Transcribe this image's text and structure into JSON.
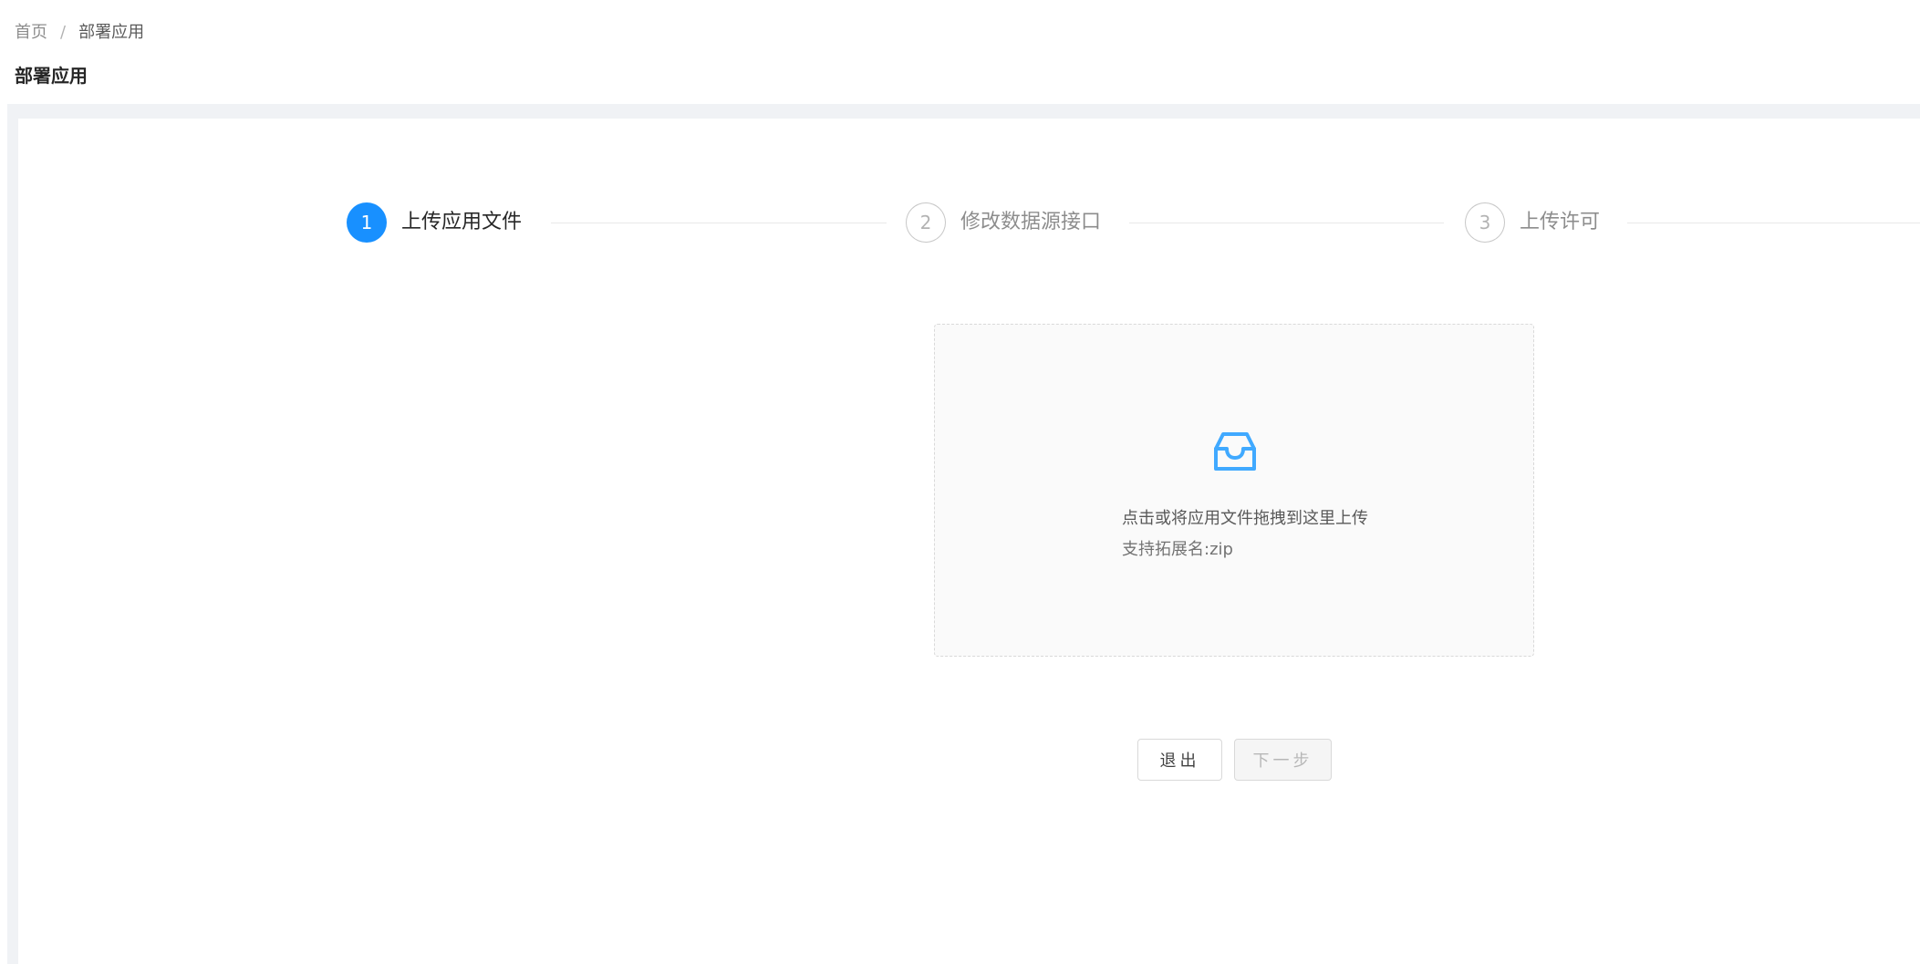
{
  "breadcrumb": {
    "home": "首页",
    "separator": "/",
    "current": "部署应用"
  },
  "page_title": "部署应用",
  "steps": [
    {
      "number": "1",
      "title": "上传应用文件",
      "status": "active"
    },
    {
      "number": "2",
      "title": "修改数据源接口",
      "status": "wait"
    },
    {
      "number": "3",
      "title": "上传许可",
      "status": "wait"
    }
  ],
  "upload": {
    "icon": "inbox-icon",
    "text": "点击或将应用文件拖拽到这里上传",
    "hint": "支持拓展名:zip"
  },
  "buttons": {
    "exit": "退出",
    "next": "下一步"
  },
  "colors": {
    "primary": "#1890ff",
    "content_bg": "#f0f2f5",
    "border": "#d9d9d9"
  }
}
